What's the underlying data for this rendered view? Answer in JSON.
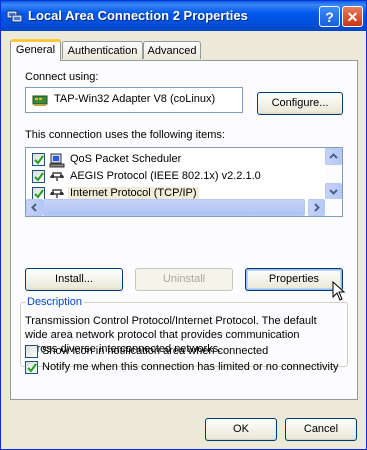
{
  "window": {
    "title": "Local Area Connection 2 Properties",
    "help_button": "?",
    "close_button": "✕"
  },
  "tabs": [
    {
      "label": "General",
      "active": true
    },
    {
      "label": "Authentication",
      "active": false
    },
    {
      "label": "Advanced",
      "active": false
    }
  ],
  "connect_using": {
    "label": "Connect using:",
    "adapter": "TAP-Win32 Adapter V8 (coLinux)",
    "configure_button": "Configure..."
  },
  "items_section": {
    "label": "This connection uses the following items:",
    "items": [
      {
        "label": "QoS Packet Scheduler",
        "checked": true,
        "icon": "scheduler-icon",
        "selected": false
      },
      {
        "label": "AEGIS Protocol (IEEE 802.1x) v2.2.1.0",
        "checked": true,
        "icon": "protocol-icon",
        "selected": false
      },
      {
        "label": "Internet Protocol (TCP/IP)",
        "checked": true,
        "icon": "protocol-icon",
        "selected": true
      }
    ]
  },
  "buttons": {
    "install": "Install...",
    "uninstall": "Uninstall",
    "properties": "Properties",
    "ok": "OK",
    "cancel": "Cancel"
  },
  "description": {
    "legend": "Description",
    "line1": "Transmission Control Protocol/Internet Protocol. The default",
    "line2": "wide area network protocol that provides communication",
    "line3": "across diverse interconnected networks."
  },
  "options": {
    "show_icon": {
      "label": "Show icon in notification area when connected",
      "checked": false
    },
    "notify_me": {
      "label": "Notify me when this connection has limited or no connectivity",
      "checked": true
    }
  },
  "colors": {
    "titlebar": "#0058ee",
    "dialog_bg": "#ece9d8",
    "group_label": "#0046d5"
  }
}
